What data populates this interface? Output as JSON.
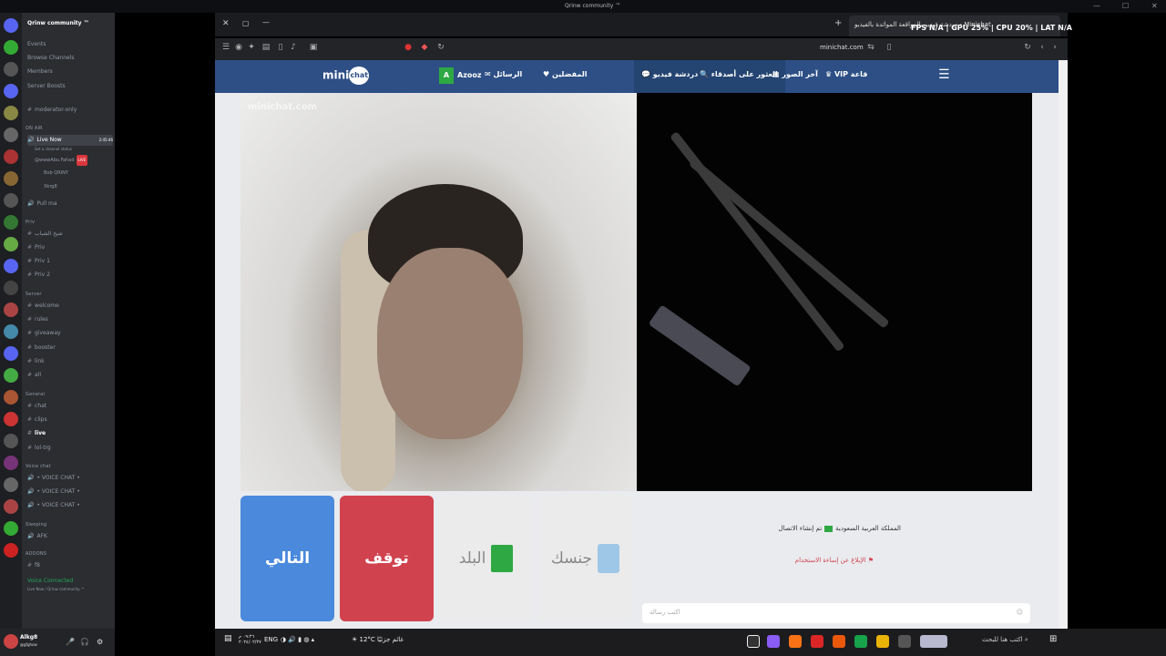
{
  "os": {
    "title": "Qrinw community ™"
  },
  "discord": {
    "server_name": "Qrinw community ™",
    "top_items": [
      "Events",
      "Browse Channels",
      "Members",
      "Server Boosts"
    ],
    "moderator": "moderator-only",
    "on_air_cat": "ON AIR",
    "live_now": "Live Now",
    "live_time": "2:45:46",
    "live_status": "Set a channel status",
    "live_user1": "@wwwAbu.Fahad",
    "live_badge": "LIVE",
    "live_user2": "Bob QRINY",
    "live_user3": "Xkrg8",
    "pull": "Pull ma",
    "priv_cat": "Priv",
    "priv_items": [
      "شيخ الشباب",
      "Priv",
      "Priv 1",
      "Priv 2"
    ],
    "server_cat": "Server",
    "server_items": [
      "welcome",
      "rules",
      "giveaway",
      "booster",
      "link",
      "all"
    ],
    "general_cat": "General",
    "general_items": [
      "chat",
      "clips",
      "live",
      "lol-trg"
    ],
    "voice_cat": "Voice chat",
    "voice_items": [
      "• VOICE CHAT •",
      "• VOICE CHAT •",
      "• VOICE CHAT •"
    ],
    "sleeping_cat": "Sleeping",
    "afk": "AFK",
    "addons_cat": "ADDONS",
    "fifa": "f8",
    "voice_connected": "Voice Connected",
    "voice_sub": "Live Now / Qrinw community ™",
    "user_name": "Alkg8",
    "user_tag": "@gfghow"
  },
  "browser": {
    "tab_title": "دردشة فيديو بالمواقعة المواتدة بالفيديو - Minichat",
    "url": "minichat.com",
    "overlay": {
      "fps": "FPS N/A",
      "gpu": "GPU 25%",
      "cpu": "CPU 20%",
      "lat": "LAT N/A"
    }
  },
  "minichat": {
    "logo": "mini",
    "logo_bubble": "chat",
    "nav": {
      "user": "Azooz",
      "user_initial": "A",
      "messages": "الرسائل",
      "favorites": "المفضلين",
      "video_chat": "دردشة فيديو",
      "search": "العثور على أصدقاء",
      "photos": "آخر الصور",
      "vip": "VIP قاعة"
    },
    "watermark": "minichat.com",
    "buttons": {
      "next": "التالي",
      "stop": "توقف",
      "country": "البلد",
      "gender": "جنسك"
    },
    "chat": {
      "connected": "تم إنشاء الاتصال",
      "country": "المملكة العربية السعودية",
      "report": "الإبلاغ عن إساءة الاستخدام",
      "placeholder": "اكتب رسالة"
    }
  },
  "taskbar": {
    "search": "اكتب هنا للبحث",
    "weather": "12°C",
    "weather_text": "غائم جزئيًا",
    "lang": "ENG",
    "time": "٠٩:٢٦ م",
    "date": "٢٠٢٤/٠٢/٢٧"
  },
  "colors": {
    "accent": "#2d4f85",
    "next": "#4a89dc",
    "stop": "#d1424f",
    "discord_bg": "#2b2d31"
  }
}
